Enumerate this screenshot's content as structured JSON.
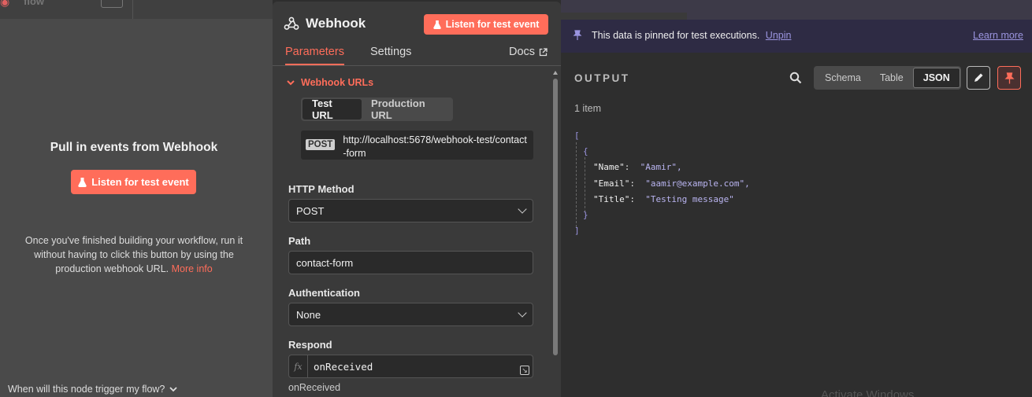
{
  "left": {
    "topbar_faded": "flow",
    "title": "Pull in events from Webhook",
    "listen_label": "Listen for test event",
    "desc_text": "Once you've finished building your workflow, run it without having to click this button by using the production webhook URL.",
    "desc_link": "More info",
    "bottom_question": "When will this node trigger my flow?"
  },
  "node": {
    "title": "Webhook",
    "listen_label": "Listen for test event",
    "tabs": [
      {
        "label": "Parameters",
        "active": true
      },
      {
        "label": "Settings",
        "active": false
      }
    ],
    "docs_label": "Docs",
    "webhook_urls_label": "Webhook URLs",
    "url_toggle": [
      {
        "label": "Test URL",
        "selected": true
      },
      {
        "label": "Production URL",
        "selected": false
      }
    ],
    "url_method": "POST",
    "url_value": "http://localhost:5678/webhook-test/contact-form",
    "http_method_label": "HTTP Method",
    "http_method_value": "POST",
    "path_label": "Path",
    "path_value": "contact-form",
    "auth_label": "Authentication",
    "auth_value": "None",
    "respond_label": "Respond",
    "respond_value": "onReceived",
    "respond_hint": "onReceived"
  },
  "output": {
    "banner_text": "This data is pinned for test executions.",
    "unpin_label": "Unpin",
    "learn_more_label": "Learn more",
    "title": "OUTPUT",
    "view_options": [
      {
        "label": "Schema",
        "selected": false
      },
      {
        "label": "Table",
        "selected": false
      },
      {
        "label": "JSON",
        "selected": true
      }
    ],
    "items_count": "1 item",
    "json_open": "[",
    "obj_open": "{",
    "entries": [
      {
        "key": "\"Name\"",
        "value": "\"Aamir\","
      },
      {
        "key": "\"Email\"",
        "value": "\"aamir@example.com\","
      },
      {
        "key": "\"Title\"",
        "value": "\"Testing message\""
      }
    ],
    "obj_close": "}",
    "json_close": "]",
    "watermark": "Activate Windows"
  },
  "colors": {
    "accent": "#ff6d5a",
    "pin_purple": "#9b95e0"
  }
}
